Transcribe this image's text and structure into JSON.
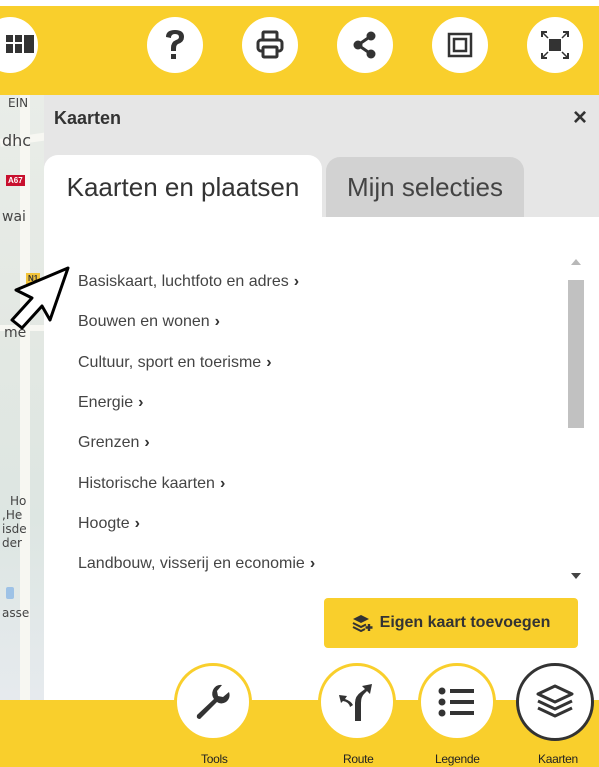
{
  "map": {
    "labels": [
      "EIN",
      "dhc",
      "wai",
      "me",
      "Ho",
      ",He",
      "isde",
      "der",
      "asse"
    ],
    "road_number": "A67",
    "road_shield2": "N1"
  },
  "toolbar": {
    "buttons": [
      {
        "name": "help",
        "icon": "question-icon"
      },
      {
        "name": "print",
        "icon": "printer-icon"
      },
      {
        "name": "share",
        "icon": "share-icon"
      },
      {
        "name": "frame",
        "icon": "frame-icon"
      },
      {
        "name": "fullscreen",
        "icon": "fullscreen-icon"
      }
    ]
  },
  "panel": {
    "title": "Kaarten",
    "close": "×",
    "tabs": [
      {
        "label": "Kaarten en plaatsen",
        "active": true
      },
      {
        "label": "Mijn selecties",
        "active": false
      }
    ],
    "categories": [
      "Basiskaart, luchtfoto en adres",
      "Bouwen en wonen",
      "Cultuur, sport en toerisme",
      "Energie",
      "Grenzen",
      "Historische kaarten",
      "Hoogte",
      "Landbouw, visserij en economie"
    ],
    "chevron": "›",
    "add_button": "Eigen kaart toevoegen"
  },
  "bottom_nav": [
    {
      "label": "Tools",
      "icon": "wrench-icon"
    },
    {
      "label": "Route",
      "icon": "route-icon"
    },
    {
      "label": "Legende",
      "icon": "list-icon"
    },
    {
      "label": "Kaarten",
      "icon": "layers-icon",
      "active": true
    }
  ],
  "colors": {
    "accent": "#f9cf2c",
    "text": "#333333",
    "tab_inactive": "#d2d2d2"
  }
}
